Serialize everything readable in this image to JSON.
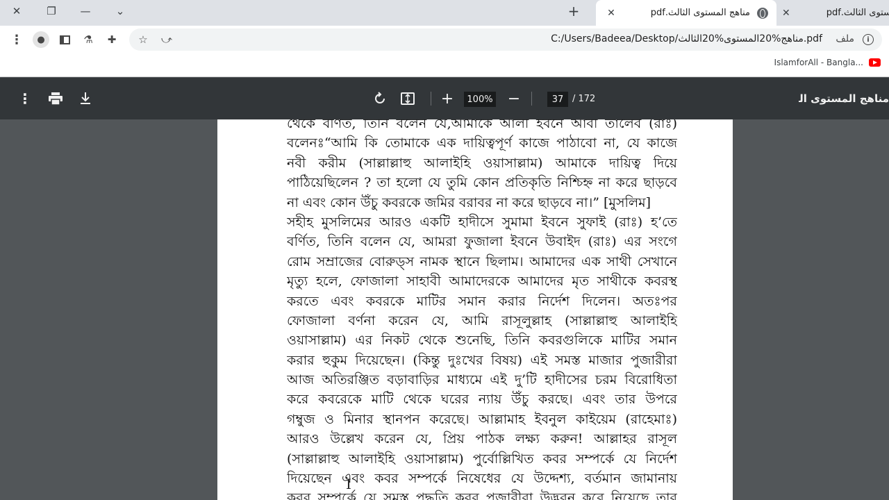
{
  "browser": {
    "tabs": [
      {
        "title": "مناهج المستوى الثالث.pdf",
        "active": true
      },
      {
        "title": "المستوى الثالث.pdf",
        "active": false
      }
    ],
    "new_tab_label": "+",
    "address_bar": {
      "url": "C:/Users/Badeea/Desktop/مناهج%20المستوى%20الثالث.pdf",
      "site_label": "ملف"
    },
    "bookmarks": [
      {
        "label": "IslamforAll - Bangla..."
      }
    ]
  },
  "pdf_viewer": {
    "title": "مناهج المستوى الثالث.pdf",
    "zoom": "100%",
    "current_page": "37",
    "total_pages": "/ 172",
    "page_lines": [
      "থেকে বর্ণিত, তিনি বলেন যে,আমাকে আলী ইবনে আবী তালেব (রাঃ)",
      "বলেনঃ“আমি কি তোমাকে এক দায়িত্বপূর্ণ কাজে পাঠাবো না, যে কাজে",
      "নবী করীম (সাল্লাল্লাহু আলাইহি ওয়াসাল্লাম) আমাকে দায়িত্ব দিয়ে",
      "পাঠিয়েছিলেন ? তা  হলো যে তুমি কোন প্রতিকৃতি নিশ্চিহ্ন না করে ছাড়বে",
      "না এবং কোন উঁচু কবরকে জমির বরাবর না করে ছাড়বে না।” [মুসলিম]",
      "সহীহ মুসলিমের আরও একটি হাদীসে সুমামা ইবনে সুফাই (রাঃ) হ’তে",
      "বর্ণিত, তিনি বলেন যে, আমরা ফুজালা ইবনে উবাইদ (রাঃ) এর সংগে",
      "রোম সম্রাজের বোরুড্স নামক স্থানে ছিলাম। আমাদের এক সাথী সেখানে",
      "মৃত্যু হলে, ফোজালা সাহাবী আমাদেরকে আমাদের মৃত সাথীকে কবরস্থ",
      "করতে এবং কবরকে মাটির সমান করার নির্দেশ দিলেন। অতঃপর",
      "ফোজালা বর্ণনা করেন যে, আমি রাসূলুল্লাহ (সাল্লাল্লাহু আলাইহি",
      "ওয়াসাল্লাম) এর নিকট থেকে শুনেছি, তিনি কবরগুলিকে মাটির সমান",
      "করার হুকুম দিয়েছেন। (কিন্তু দুঃখের বিষয়) এই সমস্ত মাজার পুজারীরা",
      "আজ অতিরঞ্জিত বড়াবাড়ির মাধ্যমে এই দু’টি হাদীসের চরম বিরোধিতা",
      "করে কবরেকে মাটি থেকে  ঘরের ন্যায় উঁচু করছে। এবং তার উপরে",
      "গম্বুজ ও মিনার স্থানপন করেছে। আল্লামাহ ইবনুল কাইয়েম (রাহেমাঃ)",
      "আরও উল্লেখ করেন যে, প্রিয় পাঠক লক্ষ্য করুন! আল্লাহর রাসূল",
      "(সাল্লাল্লাহু আলাইহি ওয়াসাল্লাম) পুর্বোল্লিখিত কবর সম্পর্কে যে নির্দেশ",
      "দিয়েছেন এবং কবর সম্পর্কে নিষেধের যে উদ্দেশ্য, বর্তমান জামানায়",
      "কবর সম্পর্কে যে সমস্ত পদ্ধতি কবর পুজারীরা উদ্ভবন করে নিয়েছে তার"
    ]
  }
}
